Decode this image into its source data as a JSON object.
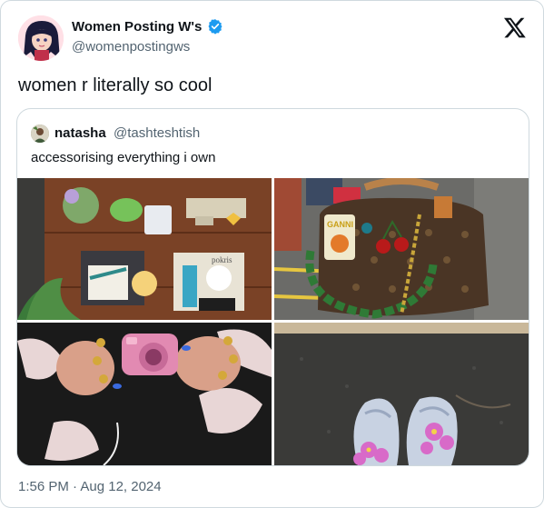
{
  "author": {
    "display_name": "Women Posting W's",
    "handle": "@womenpostingws",
    "verified": true,
    "verified_color": "#1d9bf0"
  },
  "tweet": {
    "text": "women r literally so cool",
    "timestamp": "1:56 PM · Aug 12, 2024"
  },
  "quoted_tweet": {
    "display_name": "natasha",
    "handle": "@tashteshtish",
    "text": "accessorising everything i own",
    "images": [
      {
        "id": "img-1",
        "alt_label": "pokris"
      },
      {
        "id": "img-2",
        "alt_label": "GANNI"
      },
      {
        "id": "img-3"
      },
      {
        "id": "img-4"
      }
    ]
  },
  "icons": {
    "platform_logo": "x-logo-icon",
    "verified": "verified-badge-icon"
  },
  "colors": {
    "text_primary": "#0f1419",
    "text_secondary": "#536471",
    "border": "#cfd9de"
  }
}
